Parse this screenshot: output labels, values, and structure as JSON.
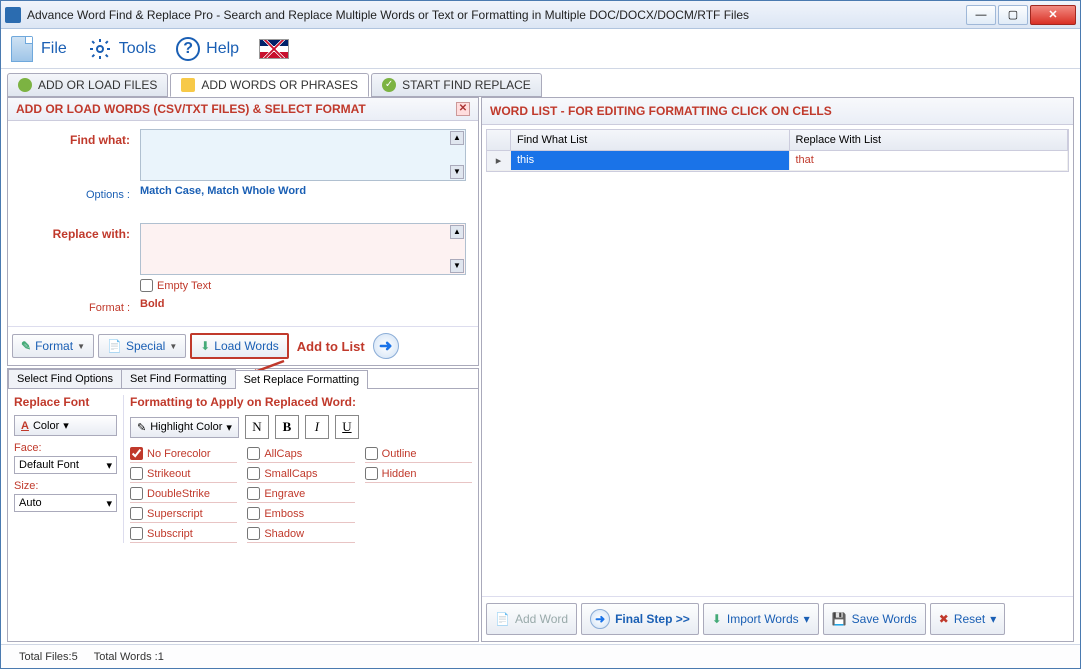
{
  "window": {
    "title": "Advance Word Find & Replace Pro - Search and Replace Multiple Words or Text  or Formatting in Multiple DOC/DOCX/DOCM/RTF Files"
  },
  "toolbar": {
    "file": "File",
    "tools": "Tools",
    "help": "Help"
  },
  "tabs": {
    "add_files": "ADD OR LOAD FILES",
    "add_words": "ADD WORDS OR PHRASES",
    "start": "START FIND REPLACE"
  },
  "left_panel": {
    "title": "ADD OR LOAD WORDS (CSV/TXT FILES) & SELECT FORMAT",
    "find_what": "Find what:",
    "options_label": "Options :",
    "options_value": "Match Case, Match Whole Word",
    "replace_with": "Replace with:",
    "empty_text": "Empty Text",
    "format_label": "Format :",
    "format_value": "Bold",
    "btn_format": "Format",
    "btn_special": "Special",
    "btn_load": "Load Words",
    "btn_addlist": "Add to List"
  },
  "subtabs": {
    "select_find": "Select Find Options",
    "set_find_fmt": "Set Find Formatting",
    "set_replace_fmt": "Set Replace Formatting"
  },
  "format_panel": {
    "replace_font": "Replace Font",
    "color": "Color",
    "face": "Face:",
    "face_value": "Default Font",
    "size": "Size:",
    "size_value": "Auto",
    "apply_title": "Formatting to Apply on Replaced Word:",
    "highlight": "Highlight Color",
    "n": "N",
    "b": "B",
    "i": "I",
    "u": "U",
    "no_forecolor": "No Forecolor",
    "strikeout": "Strikeout",
    "doublestrike": "DoubleStrike",
    "superscript": "Superscript",
    "subscript": "Subscript",
    "allcaps": "AllCaps",
    "smallcaps": "SmallCaps",
    "engrave": "Engrave",
    "emboss": "Emboss",
    "shadow": "Shadow",
    "outline": "Outline",
    "hidden": "Hidden"
  },
  "right_panel": {
    "title": "WORD LIST - FOR EDITING FORMATTING CLICK ON CELLS",
    "col_find": "Find What List",
    "col_replace": "Replace With List",
    "rows": [
      {
        "find": "this",
        "replace": "that"
      }
    ],
    "btn_add": "Add Word",
    "btn_final": "Final Step >>",
    "btn_import": "Import Words",
    "btn_save": "Save Words",
    "btn_reset": "Reset"
  },
  "status": {
    "files": "Total Files:5",
    "words": "Total Words :1"
  }
}
